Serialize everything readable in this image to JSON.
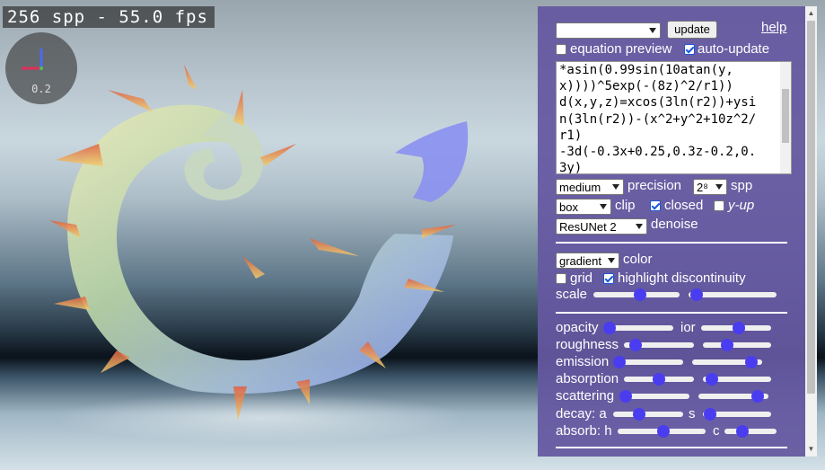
{
  "hud": {
    "fps_text": "256 spp - 55.0 fps",
    "gizmo_value": "0.2"
  },
  "colors": {
    "panel_bg": "#6558a0",
    "accent": "#4a3df0",
    "text": "#ffffff"
  },
  "panel": {
    "preset_select_value": "",
    "update_label": "update",
    "help_label": "help",
    "equation_preview_label": "equation preview",
    "equation_preview_checked": false,
    "auto_update_label": "auto-update",
    "auto_update_checked": true,
    "code_text": "*asin(0.99sin(10atan(y,\nx))))^5exp(-(8z)^2/r1))\nd(x,y,z)=xcos(3ln(r2))+ysi\nn(3ln(r2))-(x^2+y^2+10z^2/\nr1)\n-3d(-0.3x+0.25,0.3z-0.2,0.\n3y)",
    "precision_value": "medium",
    "precision_label": "precision",
    "spp_value": "2⁸",
    "spp_label": "spp",
    "clip_value": "box",
    "clip_label": "clip",
    "closed_label": "closed",
    "closed_checked": true,
    "y_up_label": "y-up",
    "y_up_checked": false,
    "denoise_value": "ResUNet 2",
    "denoise_label": "denoise",
    "color_value": "gradient",
    "color_label": "color",
    "grid_label": "grid",
    "grid_checked": false,
    "highlight_label": "highlight discontinuity",
    "highlight_checked": true,
    "scale_label": "scale",
    "scale_a_value": 0.55,
    "scale_b_value": 0.02,
    "opacity_label": "opacity",
    "opacity_value": 0.0,
    "ior_label": "ior",
    "ior_value": 0.55,
    "roughness_label": "roughness",
    "roughness_value": 0.1,
    "roughness2_value": 0.32,
    "emission_label": "emission",
    "emission_value": 0.0,
    "emission2_value": 0.92,
    "absorption_label": "absorption",
    "absorption_value": 0.5,
    "absorption2_value": 0.05,
    "scattering_label": "scattering",
    "scattering_value": 0.0,
    "scattering2_value": 0.92,
    "decay_a_label": "decay: a",
    "decay_a_value": 0.35,
    "decay_s_label": "s",
    "decay_s_value": 0.02,
    "absorb_h_label": "absorb: h",
    "absorb_h_value": 0.52,
    "absorb_c_label": "c",
    "absorb_c_value": 0.3
  }
}
